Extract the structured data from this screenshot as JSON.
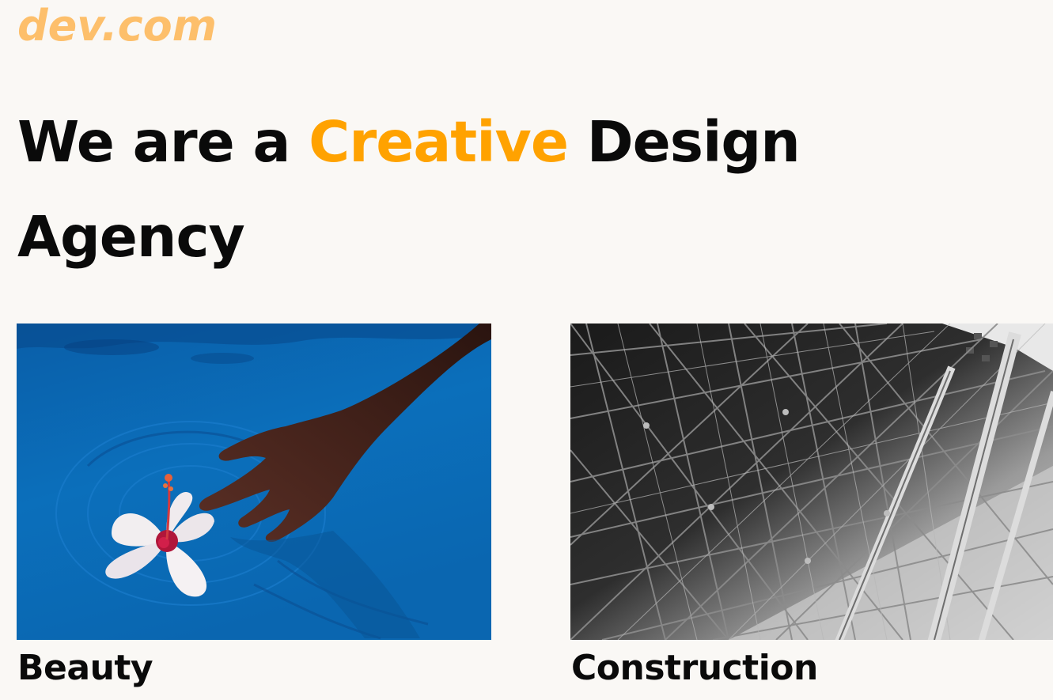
{
  "logo": {
    "text": "dev.com"
  },
  "hero": {
    "headline_part1": "We are a ",
    "headline_accent": "Creative",
    "headline_part2": " Design Agency"
  },
  "colors": {
    "background": "#faf8f5",
    "logo": "#fdbf6b",
    "accent": "#ffa200",
    "text": "#0a0a0a"
  },
  "cards": [
    {
      "title": "Beauty",
      "image": "hand-touching-hibiscus-flower-in-blue-water"
    },
    {
      "title": "Construction",
      "image": "black-and-white-steel-truss-structure"
    }
  ]
}
